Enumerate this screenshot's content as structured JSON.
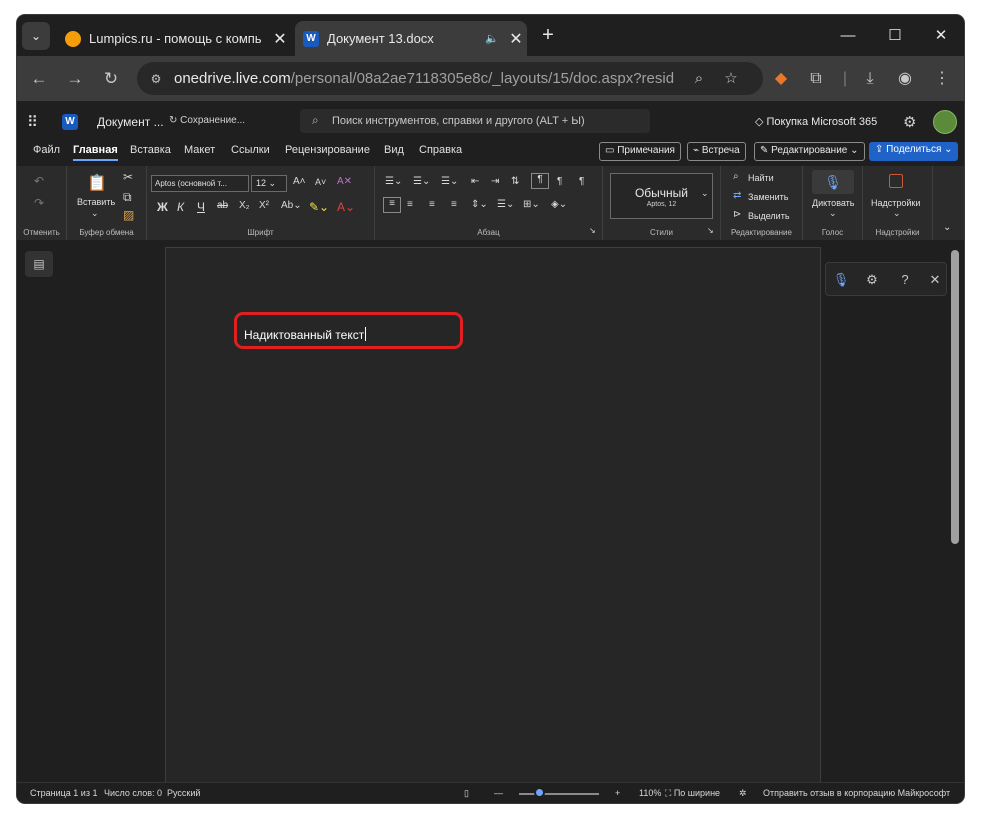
{
  "browser": {
    "tabs": [
      {
        "title": "Lumpics.ru - помощь с компь",
        "favicon": "lumpics-favicon-icon",
        "active": false
      },
      {
        "title": "Документ 13.docx",
        "favicon": "word-favicon-icon",
        "active": true
      }
    ],
    "url_host": "onedrive.live.com",
    "url_path": "/personal/08a2ae7118305e8c/_layouts/15/doc.aspx?resid=0e...",
    "new_tab_icon": "plus-icon"
  },
  "word": {
    "app_icon_text": "W",
    "doc_name": "Документ ...",
    "save_status": "Сохранение...",
    "search_placeholder": "Поиск инструментов, справки и другого (ALT + Ы)",
    "buy_label": "Покупка Microsoft 365",
    "ribbon_tabs": [
      "Файл",
      "Главная",
      "Вставка",
      "Макет",
      "Ссылки",
      "Рецензирование",
      "Вид",
      "Справка"
    ],
    "active_ribbon_tab": "Главная",
    "comments_label": "Примечания",
    "meeting_label": "Встреча",
    "editing_label": "Редактирование",
    "share_label": "Поделиться",
    "groups": {
      "undo": "Отменить",
      "clipboard": "Буфер обмена",
      "font": "Шрифт",
      "paragraph": "Абзац",
      "styles": "Стили",
      "editing": "Редактирование",
      "voice": "Голос",
      "addins": "Надстройки"
    },
    "paste_label": "Вставить",
    "font_name": "Aptos (основной т...",
    "font_size": "12",
    "style_name": "Обычный",
    "style_font": "Aptos, 12",
    "find_label": "Найти",
    "replace_label": "Заменить",
    "select_label": "Выделить",
    "dictate_label": "Диктовать",
    "addins_label": "Надстройки",
    "document_text": "Надиктованный текст"
  },
  "status": {
    "page": "Страница 1 из 1",
    "words": "Число слов: 0",
    "language": "Русский",
    "zoom": "110%",
    "fit": "По ширине",
    "feedback": "Отправить отзыв в корпорацию Майкрософт"
  },
  "colors": {
    "accent": "#1f62c8",
    "highlight_box": "#e02020",
    "word_brand": "#185abd"
  }
}
